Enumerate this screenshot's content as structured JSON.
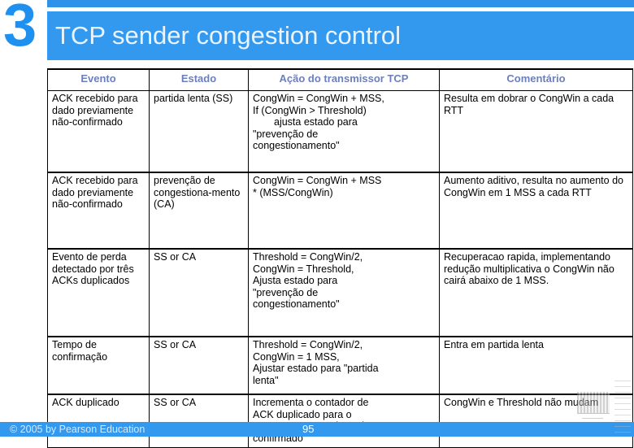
{
  "slide": {
    "number_glyph": "3",
    "title": "TCP sender congestion control",
    "accent_color": "#3399ee",
    "glyph_color": "#1e90f0",
    "header_text_color": "#6b7fbf"
  },
  "table": {
    "headers": {
      "evento": "Evento",
      "estado": "Estado",
      "acao": "Ação do transmissor TCP",
      "comentario": "Comentário"
    },
    "rows": [
      {
        "evento": "ACK recebido para dado previamente não-confirmado",
        "estado": "partida lenta (SS)",
        "acao_lines": [
          "CongWin = CongWin + MSS,",
          "If (CongWin > Threshold)",
          "ajusta estado para",
          "\"prevenção de",
          "congestionamento\""
        ],
        "acao_indent": [
          false,
          false,
          true,
          false,
          false
        ],
        "comentario": "Resulta em dobrar o CongWin a cada RTT"
      },
      {
        "evento": "ACK recebido para dado previamente não-confirmado",
        "estado": "prevenção de congestiona-mento (CA)",
        "acao_lines": [
          "CongWin = CongWin + MSS",
          "* (MSS/CongWin)"
        ],
        "acao_indent": [
          false,
          false
        ],
        "comentario": "Aumento aditivo, resulta no aumento do CongWin em 1 MSS a cada RTT"
      },
      {
        "evento": "Evento de perda detectado por três ACKs duplicados",
        "estado": "SS or CA",
        "acao_lines": [
          "Threshold = CongWin/2,",
          "CongWin = Threshold,",
          "Ajusta estado para",
          "\"prevenção de",
          "congestionamento\""
        ],
        "acao_indent": [
          false,
          false,
          false,
          false,
          false
        ],
        "comentario": "Recuperacao rapida, implementando redução multiplicativa o CongWin não cairá abaixo de 1 MSS."
      },
      {
        "evento": "Tempo de confirmação",
        "estado": "SS or CA",
        "acao_lines": [
          "Threshold = CongWin/2,",
          "CongWin = 1 MSS,",
          "Ajustar estado para \"partida",
          "lenta\""
        ],
        "acao_indent": [
          false,
          false,
          false,
          false
        ],
        "comentario": "Entra em partida lenta"
      },
      {
        "evento": "ACK duplicado",
        "estado": "SS or CA",
        "acao_lines": [
          "Incrementa o contador de",
          "ACK duplicado para o",
          "segmento que está sendo",
          "confirmado"
        ],
        "acao_indent": [
          false,
          false,
          false,
          false
        ],
        "comentario": "CongWin e Threshold não mudam"
      }
    ]
  },
  "footer": {
    "credit": "© 2005 by Pearson Education",
    "page_number": "95"
  }
}
